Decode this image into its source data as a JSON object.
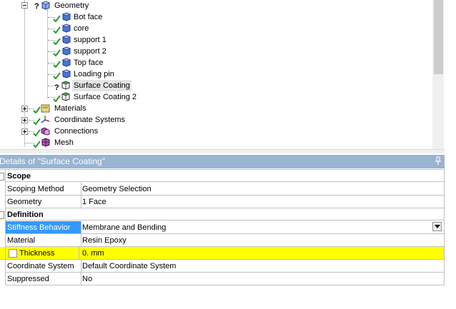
{
  "tree": {
    "items": [
      {
        "label": "Geometry",
        "state": "question"
      },
      {
        "label": "Bot face",
        "state": "ok"
      },
      {
        "label": "core",
        "state": "ok"
      },
      {
        "label": "support 1",
        "state": "ok"
      },
      {
        "label": "support 2",
        "state": "ok"
      },
      {
        "label": "Top face",
        "state": "ok"
      },
      {
        "label": "Loading pin",
        "state": "ok"
      },
      {
        "label": "Surface Coating",
        "state": "question",
        "selected": true
      },
      {
        "label": "Surface Coating 2",
        "state": "ok"
      },
      {
        "label": "Materials",
        "state": "ok"
      },
      {
        "label": "Coordinate Systems",
        "state": "ok"
      },
      {
        "label": "Connections",
        "state": "ok"
      },
      {
        "label": "Mesh",
        "state": "ok"
      }
    ]
  },
  "details": {
    "title": "Details of \"Surface Coating\"",
    "pin_icon": "pin-icon"
  },
  "grid": {
    "categories": {
      "scope": "Scope",
      "definition": "Definition"
    },
    "scoping_method": {
      "name": "Scoping Method",
      "value": "Geometry Selection"
    },
    "geometry": {
      "name": "Geometry",
      "value": "1 Face"
    },
    "stiffness_behavior": {
      "name": "Stiffness Behavior",
      "value": "Membrane and Bending"
    },
    "material": {
      "name": "Material",
      "value": "Resin Epoxy"
    },
    "thickness": {
      "name": "Thickness",
      "value": "0. mm"
    },
    "coordinate_system": {
      "name": "Coordinate System",
      "value": "Default Coordinate System"
    },
    "suppressed": {
      "name": "Suppressed",
      "value": "No"
    }
  },
  "colors": {
    "header_bg": "#99b4d1",
    "selected_bg": "#3399ff",
    "highlight_bg": "#ffff00"
  }
}
